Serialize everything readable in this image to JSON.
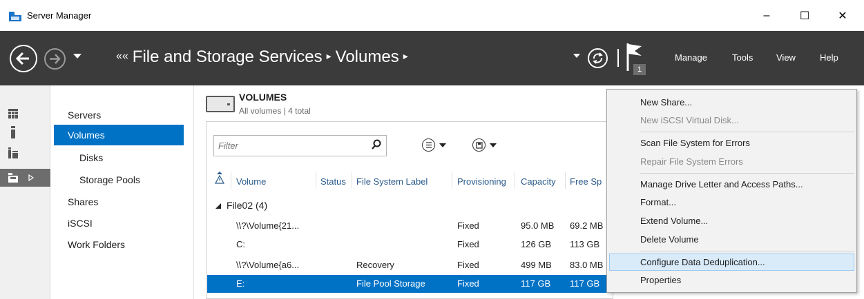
{
  "window": {
    "title": "Server Manager",
    "minimize": "–",
    "maximize": "☐",
    "close": "✕"
  },
  "header": {
    "breadcrumb": [
      "File and Storage Services",
      "Volumes"
    ],
    "breadcrumb_prefix": "««",
    "breadcrumb_arrow": "▸",
    "notification_count": "1",
    "menu": [
      "Manage",
      "Tools",
      "View",
      "Help"
    ]
  },
  "nav": {
    "items": [
      {
        "label": "Servers",
        "sub": false,
        "active": false
      },
      {
        "label": "Volumes",
        "sub": false,
        "active": true
      },
      {
        "label": "Disks",
        "sub": true,
        "active": false
      },
      {
        "label": "Storage Pools",
        "sub": true,
        "active": false
      },
      {
        "label": "Shares",
        "sub": false,
        "active": false
      },
      {
        "label": "iSCSI",
        "sub": false,
        "active": false
      },
      {
        "label": "Work Folders",
        "sub": false,
        "active": false
      }
    ]
  },
  "volumes": {
    "title": "VOLUMES",
    "subtitle": "All volumes | 4 total",
    "filter_placeholder": "Filter",
    "columns": [
      "Volume",
      "Status",
      "File System Label",
      "Provisioning",
      "Capacity",
      "Free Sp"
    ],
    "group": "File02 (4)",
    "rows": [
      {
        "volume": "\\\\?\\Volume{21...",
        "status": "",
        "label": "",
        "provisioning": "Fixed",
        "capacity": "95.0 MB",
        "free": "69.2 MB",
        "selected": false
      },
      {
        "volume": "C:",
        "status": "",
        "label": "",
        "provisioning": "Fixed",
        "capacity": "126 GB",
        "free": "113 GB",
        "selected": false
      },
      {
        "volume": "\\\\?\\Volume{a6...",
        "status": "",
        "label": "Recovery",
        "provisioning": "Fixed",
        "capacity": "499 MB",
        "free": "83.0 MB",
        "selected": false
      },
      {
        "volume": "E:",
        "status": "",
        "label": "File Pool Storage",
        "provisioning": "Fixed",
        "capacity": "117 GB",
        "free": "117 GB",
        "selected": true
      }
    ]
  },
  "context_menu": {
    "items": [
      {
        "label": "New Share...",
        "disabled": false
      },
      {
        "label": "New iSCSI Virtual Disk...",
        "disabled": true
      },
      {
        "label": "Scan File System for Errors",
        "disabled": false
      },
      {
        "label": "Repair File System Errors",
        "disabled": true
      },
      {
        "label": "Manage Drive Letter and Access Paths...",
        "disabled": false
      },
      {
        "label": "Format...",
        "disabled": false
      },
      {
        "label": "Extend Volume...",
        "disabled": false
      },
      {
        "label": "Delete Volume",
        "disabled": false
      },
      {
        "label": "Configure Data Deduplication...",
        "disabled": false,
        "highlighted": true
      },
      {
        "label": "Properties",
        "disabled": false
      }
    ]
  },
  "colors": {
    "header_bg": "#3b3b3b",
    "accent": "#0072c6",
    "menu_bg": "#f2f2f2",
    "menu_hover": "#d9ebf9"
  }
}
